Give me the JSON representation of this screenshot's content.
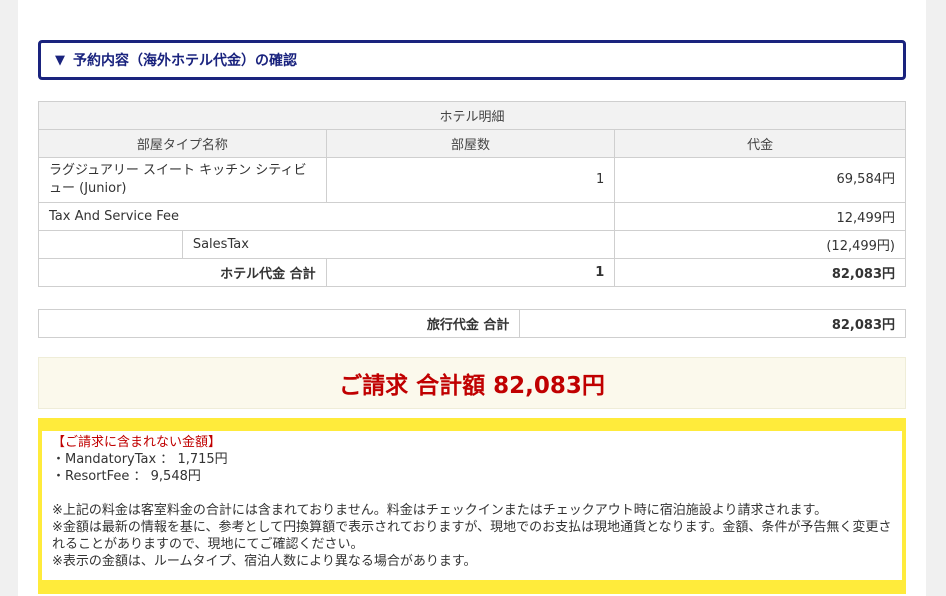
{
  "section": {
    "triangle": "▼",
    "title": "予約内容（海外ホテル代金）の確認"
  },
  "hotel_table": {
    "caption": "ホテル明細",
    "headers": [
      "部屋タイプ名称",
      "部屋数",
      "代金"
    ],
    "room": {
      "name": "ラグジュアリー スイート キッチン シティビュー (Junior)",
      "count": "1",
      "price": "69,584円"
    },
    "tax_fee": {
      "label": "Tax And Service Fee",
      "price": "12,499円"
    },
    "sales_tax": {
      "label": "SalesTax",
      "price": "(12,499円)"
    },
    "total": {
      "label": "ホテル代金 合計",
      "count": "1",
      "price": "82,083円"
    }
  },
  "travel_total": {
    "label": "旅行代金 合計",
    "price": "82,083円"
  },
  "billing": {
    "text": "ご請求 合計額 82,083円"
  },
  "notes": {
    "heading": "【ご請求に含まれない金額】",
    "items": [
      "・MandatoryTax ： 1,715円",
      "・ResortFee ： 9,548円"
    ],
    "remarks": [
      "※上記の料金は客室料金の合計には含まれておりません。料金はチェックインまたはチェックアウト時に宿泊施設より請求されます。",
      "※金額は最新の情報を基に、参考として円換算額で表示されておりますが、現地でのお支払は現地通貨となります。金額、条件が予告無く変更されることがありますので、現地にてご確認ください。",
      "※表示の金額は、ルームタイプ、宿泊人数により異なる場合があります。"
    ]
  },
  "colors": {
    "accent": "#1a237e",
    "billing_red": "#c00000",
    "notes_yellow": "#ffeb3b"
  }
}
